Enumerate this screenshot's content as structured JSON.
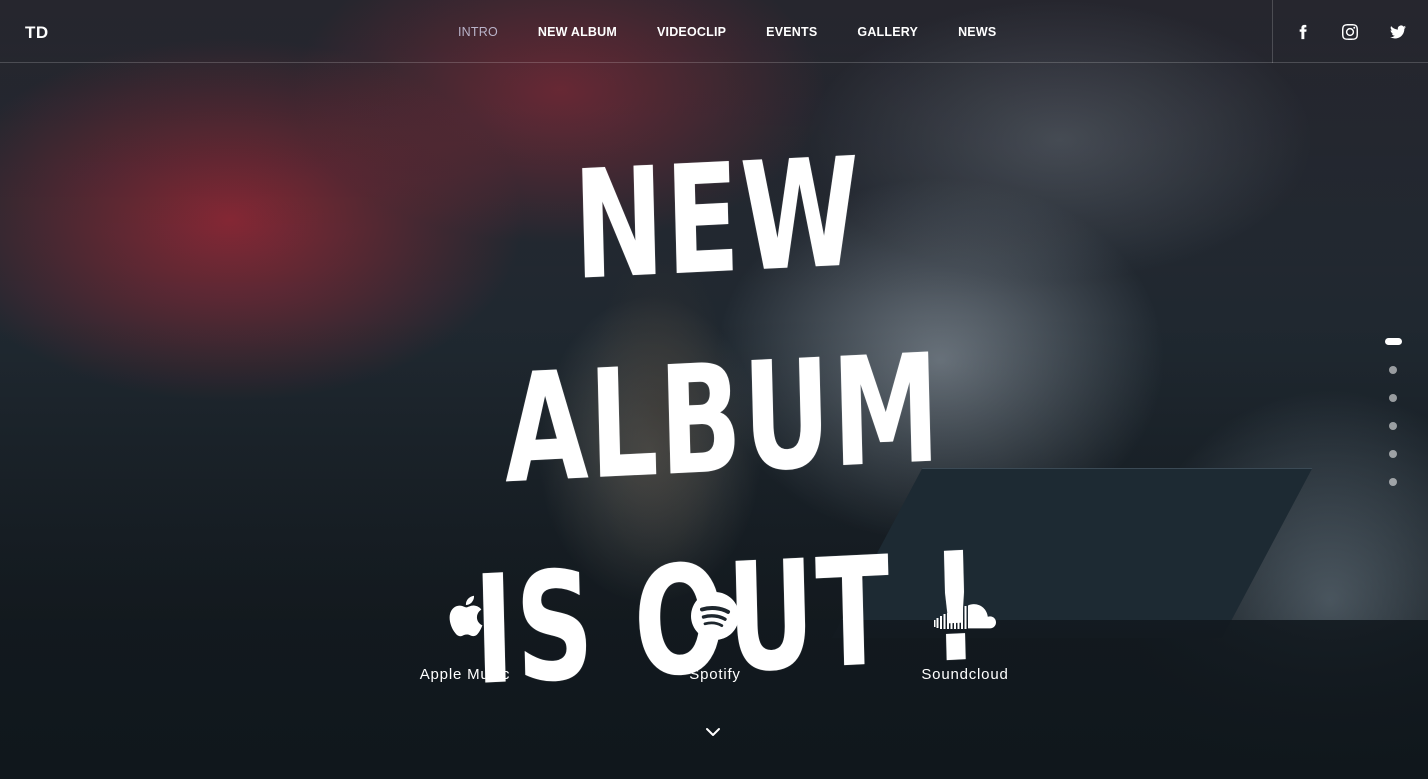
{
  "header": {
    "logo": "TD",
    "nav": [
      {
        "label": "INTRO",
        "active": true
      },
      {
        "label": "NEW ALBUM",
        "active": false
      },
      {
        "label": "VIDEOCLIP",
        "active": false
      },
      {
        "label": "EVENTS",
        "active": false
      },
      {
        "label": "GALLERY",
        "active": false
      },
      {
        "label": "NEWS",
        "active": false
      }
    ],
    "social_icons": [
      "facebook-icon",
      "instagram-icon",
      "twitter-icon"
    ]
  },
  "hero": {
    "headline_line1": "NEW ALBUM",
    "headline_line2": "IS OUT !"
  },
  "streams": [
    {
      "label": "Apple Music",
      "icon": "apple-icon"
    },
    {
      "label": "Spotify",
      "icon": "spotify-icon"
    },
    {
      "label": "Soundcloud",
      "icon": "soundcloud-icon"
    }
  ],
  "pagination": {
    "count": 6,
    "active_index": 0
  },
  "colors": {
    "nav_active": "#b9b3c9",
    "text": "#ffffff"
  }
}
